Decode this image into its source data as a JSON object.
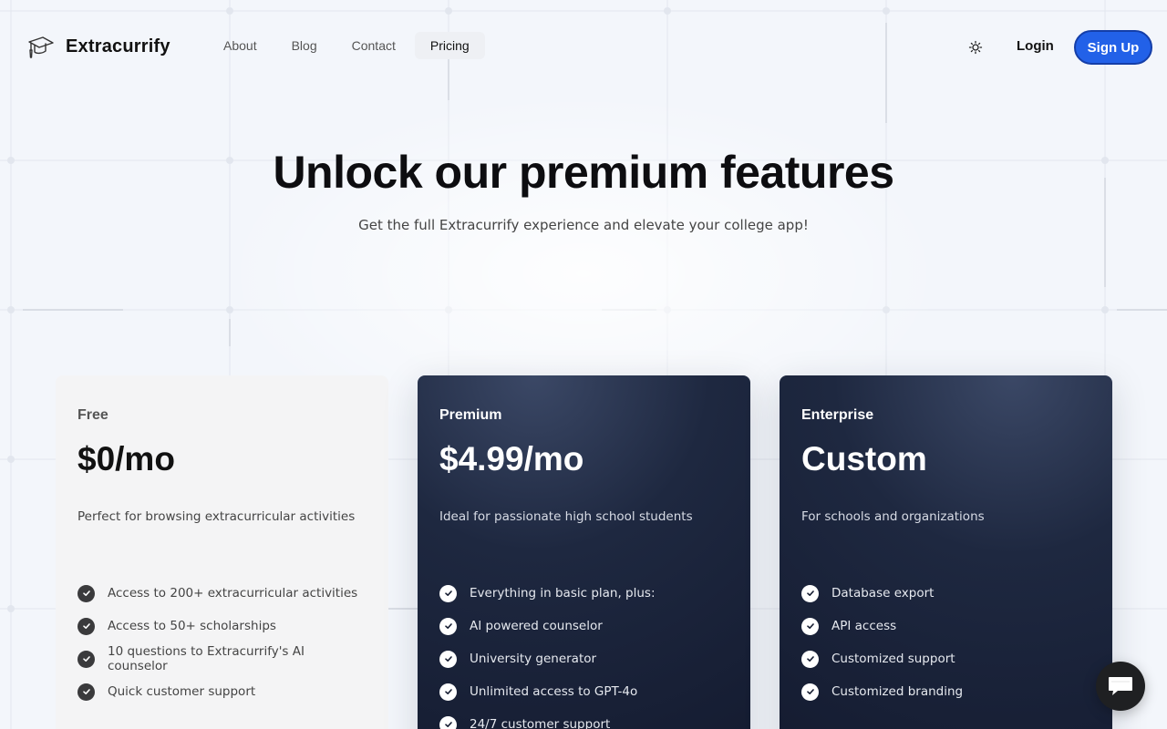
{
  "brand": {
    "name": "Extracurrify",
    "logo_icon": "graduation-cap-icon"
  },
  "nav": {
    "items": [
      {
        "label": "About",
        "active": false
      },
      {
        "label": "Blog",
        "active": false
      },
      {
        "label": "Contact",
        "active": false
      },
      {
        "label": "Pricing",
        "active": true
      }
    ]
  },
  "header": {
    "theme_icon": "sun-icon",
    "login_label": "Login",
    "signup_label": "Sign Up"
  },
  "hero": {
    "title": "Unlock our premium features",
    "subtitle": "Get the full Extracurrify experience and elevate your college app!"
  },
  "plans": [
    {
      "name": "Free",
      "price": "$0/mo",
      "description": "Perfect for browsing extracurricular activities",
      "features": [
        "Access to 200+ extracurricular activities",
        "Access to 50+ scholarships",
        "10 questions to Extracurrify's AI counselor",
        "Quick customer support"
      ]
    },
    {
      "name": "Premium",
      "price": "$4.99/mo",
      "description": "Ideal for passionate high school students",
      "features": [
        "Everything in basic plan, plus:",
        "AI powered counselor",
        "University generator",
        "Unlimited access to GPT-4o",
        "24/7 customer support"
      ]
    },
    {
      "name": "Enterprise",
      "price": "Custom",
      "description": "For schools and organizations",
      "features": [
        "Database export",
        "API access",
        "Customized support",
        "Customized branding"
      ]
    }
  ],
  "chat": {
    "icon": "chat-bubble-icon"
  },
  "colors": {
    "accent": "#2261e8",
    "accent_border": "#143ea8",
    "dark_card": "#141b30",
    "light_card": "#f4f4f5",
    "background": "#f3f6fb"
  }
}
